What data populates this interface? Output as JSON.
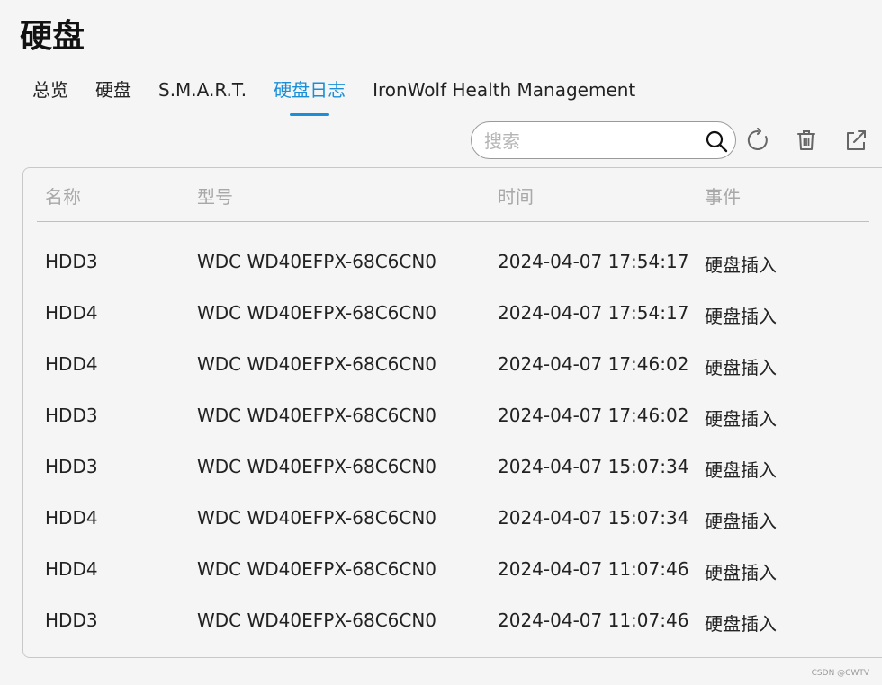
{
  "page_title": "硬盘",
  "tabs": [
    {
      "label": "总览",
      "active": false
    },
    {
      "label": "硬盘",
      "active": false
    },
    {
      "label": "S.M.A.R.T.",
      "active": false
    },
    {
      "label": "硬盘日志",
      "active": true
    },
    {
      "label": "IronWolf Health Management",
      "active": false
    }
  ],
  "search": {
    "placeholder": "搜索",
    "value": ""
  },
  "toolbar": {
    "icons": [
      "refresh-icon",
      "trash-icon",
      "export-icon"
    ]
  },
  "table": {
    "headers": [
      "名称",
      "型号",
      "时间",
      "事件"
    ],
    "rows": [
      [
        "HDD3",
        "WDC WD40EFPX-68C6CN0",
        "2024-04-07 17:54:17",
        "硬盘插入"
      ],
      [
        "HDD4",
        "WDC WD40EFPX-68C6CN0",
        "2024-04-07 17:54:17",
        "硬盘插入"
      ],
      [
        "HDD4",
        "WDC WD40EFPX-68C6CN0",
        "2024-04-07 17:46:02",
        "硬盘插入"
      ],
      [
        "HDD3",
        "WDC WD40EFPX-68C6CN0",
        "2024-04-07 17:46:02",
        "硬盘插入"
      ],
      [
        "HDD3",
        "WDC WD40EFPX-68C6CN0",
        "2024-04-07 15:07:34",
        "硬盘插入"
      ],
      [
        "HDD4",
        "WDC WD40EFPX-68C6CN0",
        "2024-04-07 15:07:34",
        "硬盘插入"
      ],
      [
        "HDD4",
        "WDC WD40EFPX-68C6CN0",
        "2024-04-07 11:07:46",
        "硬盘插入"
      ],
      [
        "HDD3",
        "WDC WD40EFPX-68C6CN0",
        "2024-04-07 11:07:46",
        "硬盘插入"
      ]
    ]
  },
  "watermark": "CSDN @CWTV",
  "colors": {
    "accent": "#1a8fd8",
    "background": "#f5f5f5",
    "header_text": "#a8a8a8"
  }
}
